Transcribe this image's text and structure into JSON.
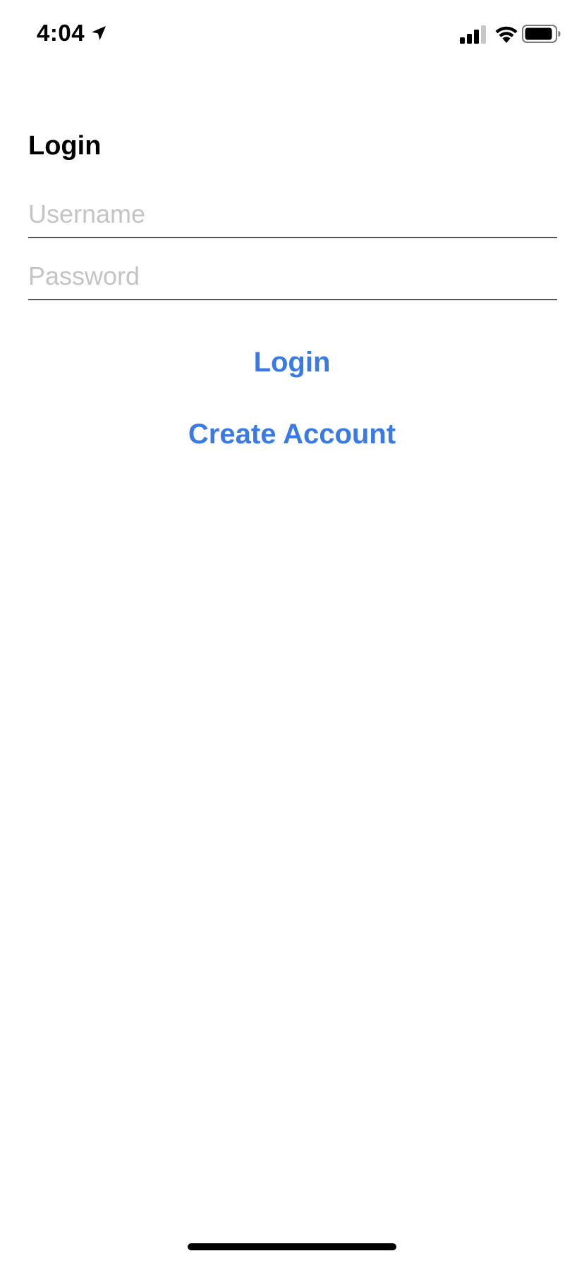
{
  "status_bar": {
    "time": "4:04",
    "icons": [
      "location-arrow-icon",
      "cellular-signal-icon",
      "wifi-icon",
      "battery-icon"
    ]
  },
  "screen": {
    "title": "Login"
  },
  "form": {
    "username_placeholder": "Username",
    "password_placeholder": "Password",
    "login_label": "Login",
    "create_account_label": "Create Account"
  },
  "colors": {
    "accent": "#3a7ae4",
    "placeholder": "#c4c4c6",
    "underline": "#555555"
  }
}
